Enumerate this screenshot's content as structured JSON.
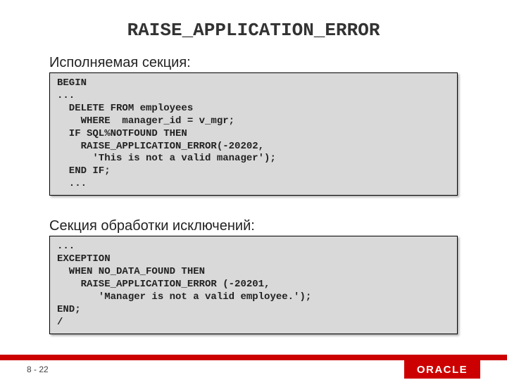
{
  "title": "RAISE_APPLICATION_ERROR",
  "sections": [
    {
      "label": "Исполняемая секция:",
      "code": "BEGIN\n...\n  DELETE FROM employees\n    WHERE  manager_id = v_mgr;\n  IF SQL%NOTFOUND THEN\n    RAISE_APPLICATION_ERROR(-20202,\n      'This is not a valid manager');\n  END IF;\n  ..."
    },
    {
      "label": "Секция обработки исключений:",
      "code": "...\nEXCEPTION\n  WHEN NO_DATA_FOUND THEN\n    RAISE_APPLICATION_ERROR (-20201,\n       'Manager is not a valid employee.');\nEND;\n/"
    }
  ],
  "page_number": "8 - 22",
  "logo_text": "ORACLE"
}
